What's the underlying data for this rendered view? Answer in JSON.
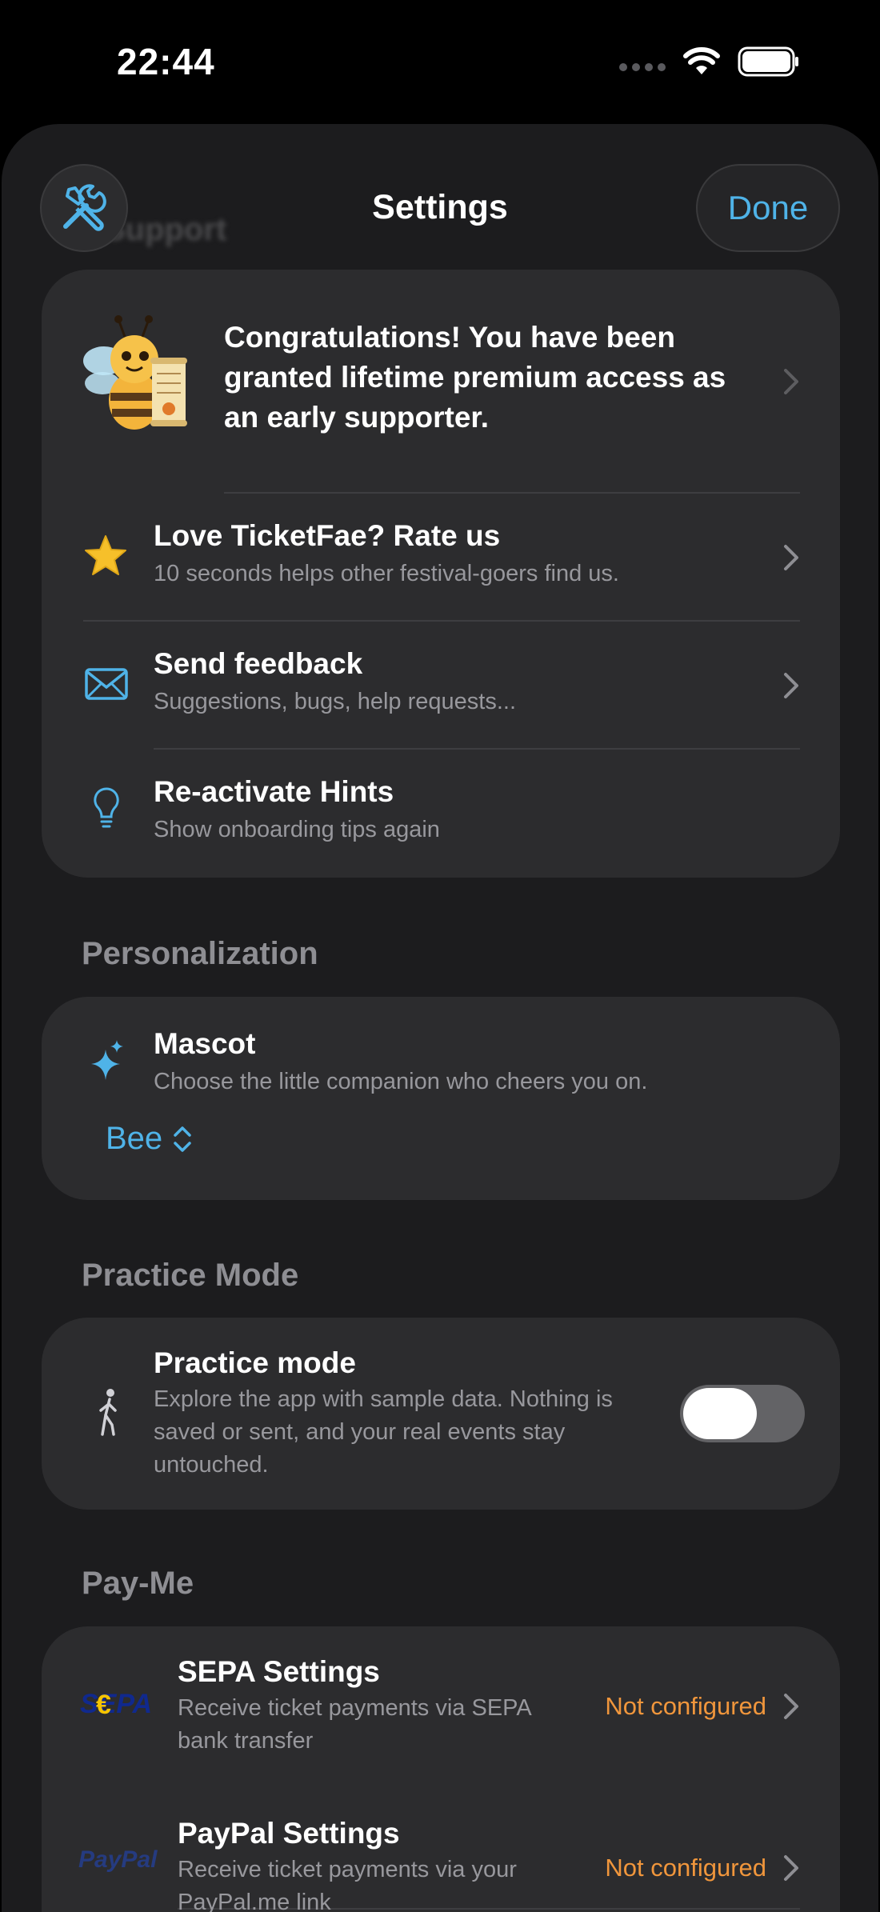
{
  "status_bar": {
    "time": "22:44"
  },
  "nav": {
    "title": "Settings",
    "done_label": "Done",
    "ghost_header": "Support"
  },
  "support": {
    "promo_text": "Congratulations! You have been granted lifetime premium access as an early supporter.",
    "promo_scroll_text": "Congratulations!",
    "rate_title": "Love TicketFae? Rate us",
    "rate_sub": "10 seconds helps other festival-goers find us.",
    "feedback_title": "Send feedback",
    "feedback_sub": "Suggestions, bugs, help requests...",
    "hints_title": "Re-activate Hints",
    "hints_sub": "Show onboarding tips again"
  },
  "personalization": {
    "header": "Personalization",
    "mascot_title": "Mascot",
    "mascot_sub": "Choose the little companion who cheers you on.",
    "mascot_value": "Bee"
  },
  "practice": {
    "header": "Practice Mode",
    "title": "Practice mode",
    "sub": "Explore the app with sample data. Nothing is saved or sent, and your real events stay untouched.",
    "enabled": false
  },
  "payme": {
    "header": "Pay-Me",
    "sepa_logo": "SEPA",
    "sepa_title": "SEPA Settings",
    "sepa_sub": "Receive ticket payments via SEPA bank transfer",
    "sepa_status": "Not configured",
    "paypal_logo": "PayPal",
    "paypal_title": "PayPal Settings",
    "paypal_sub": "Receive ticket payments via your PayPal.me link",
    "paypal_status": "Not configured"
  },
  "colors": {
    "accent": "#4fb3e8",
    "warning": "#f0963c",
    "card": "#2c2c2e",
    "background": "#1c1c1e"
  }
}
